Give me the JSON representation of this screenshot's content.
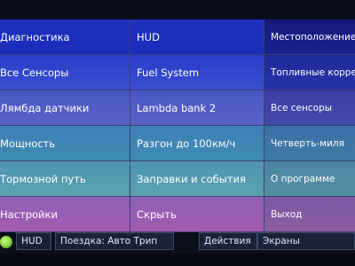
{
  "menu": {
    "col0": [
      "Диагностика",
      "Все Сенсоры",
      "Лямбда датчики",
      "Мощность",
      "Тормозной путь",
      "Настройки"
    ],
    "col1": [
      "HUD",
      "Fuel System",
      "Lambda bank 2",
      "Разгон до 100км/ч",
      "Заправки и события",
      "Скрыть"
    ],
    "col2": [
      "Местоположение",
      "Топливные корре",
      "Все сенсоры",
      "Четверть-миля",
      "О программе",
      "Выход"
    ]
  },
  "statusbar": {
    "hud_label": "HUD",
    "trip_label": "Поездка: Авто Трип",
    "actions_label": "Действия",
    "screens_label": "Экраны"
  },
  "colors": {
    "background": "#0a0d1a",
    "indicator": "#7fd13a"
  }
}
